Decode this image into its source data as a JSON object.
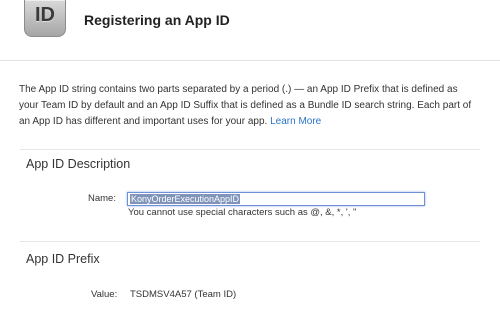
{
  "header": {
    "icon_text": "ID",
    "title": "Registering an App ID"
  },
  "intro": {
    "text": "The App ID string contains two parts separated by a period (.) — an App ID Prefix that is defined as your Team ID by default and an App ID Suffix that is defined as a Bundle ID search string. Each part of an App ID has different and important uses for your app.",
    "link": "Learn More"
  },
  "description_section": {
    "title": "App ID Description",
    "name_label": "Name:",
    "name_value": "KonyOrderExecutionAppID",
    "hint": "You cannot use special characters such as @, &, *, ', \""
  },
  "prefix_section": {
    "title": "App ID Prefix",
    "value_label": "Value:",
    "value": "TSDMSV4A57 (Team ID)"
  },
  "colors": {
    "link": "#2b73c7",
    "input_focus_border": "#6f8fd6",
    "selection": "#7f94b8"
  }
}
